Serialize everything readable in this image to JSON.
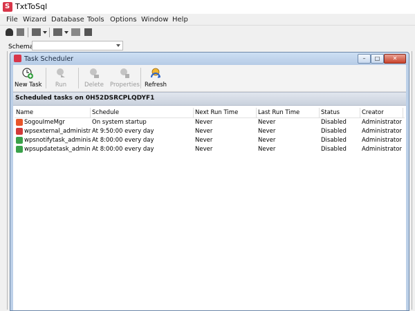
{
  "app": {
    "title": "TxtToSql",
    "logo_glyph": "S"
  },
  "menu": [
    "File",
    "Wizard",
    "Database",
    "Tools",
    "Options",
    "Window",
    "Help"
  ],
  "schema": {
    "label": "Schema",
    "value": ""
  },
  "window": {
    "title": "Task Scheduler",
    "buttons": {
      "minimize": "–",
      "maximize": "□",
      "close": "✕"
    }
  },
  "task_toolbar": {
    "new_task": "New Task",
    "run": "Run",
    "delete": "Delete",
    "properties": "Properties",
    "refresh": "Refresh"
  },
  "banner": "Scheduled tasks on 0H52DSRCPLQDYF1",
  "table": {
    "columns": [
      "Name",
      "Schedule",
      "Next Run Time",
      "Last Run Time",
      "Status",
      "Creator"
    ],
    "rows": [
      {
        "icon": "sogou-icon",
        "color": "#e8552a",
        "name": "SogouImeMgr",
        "schedule": "On system startup",
        "next": "Never",
        "last": "Never",
        "status": "Disabled",
        "creator": "Administrator"
      },
      {
        "icon": "wps-red-icon",
        "color": "#d23a3a",
        "name": "wpsexternal_administr...",
        "schedule": "At 9:50:00 every day",
        "next": "Never",
        "last": "Never",
        "status": "Disabled",
        "creator": "Administrator"
      },
      {
        "icon": "wps-green-icon",
        "color": "#3aa14a",
        "name": "wpsnotifytask_adminis...",
        "schedule": "At 8:00:00 every day",
        "next": "Never",
        "last": "Never",
        "status": "Disabled",
        "creator": "Administrator"
      },
      {
        "icon": "wps-green-icon",
        "color": "#3aa14a",
        "name": "wpsupdatetask_admini...",
        "schedule": "At 8:00:00 every day",
        "next": "Never",
        "last": "Never",
        "status": "Disabled",
        "creator": "Administrator"
      }
    ]
  },
  "colors": {
    "banner_bg": "#d3dae5",
    "window_frame": "#bcd0e8",
    "close_red": "#c9432c"
  }
}
